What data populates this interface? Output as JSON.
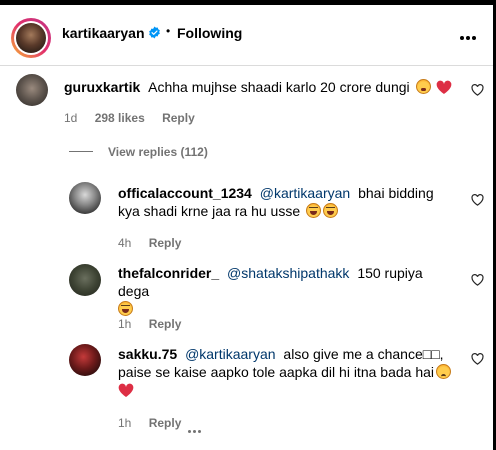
{
  "header": {
    "username": "kartikaaryan",
    "separator": "•",
    "follow_status": "Following"
  },
  "main_comment": {
    "username": "guruxkartik",
    "text": "Achha mujhse shaadi karlo 20 crore dungi",
    "time": "1d",
    "likes": "298 likes",
    "reply_label": "Reply",
    "view_replies": "View replies (112)"
  },
  "replies": [
    {
      "username": "officalaccount_1234",
      "mention": "@kartikaaryan",
      "text": "bhai bidding kya shadi krne jaa ra hu usse",
      "time": "4h",
      "reply_label": "Reply"
    },
    {
      "username": "thefalconrider_",
      "mention": "@shatakshipathakk",
      "text": "150 rupiya dega",
      "time": "1h",
      "reply_label": "Reply"
    },
    {
      "username": "sakku.75",
      "mention": "@kartikaaryan",
      "text": "also give me a chance",
      "text2": "paise se kaise aapko tole aapka dil hi itna bada hai",
      "time": "1h",
      "reply_label": "Reply"
    }
  ],
  "colors": {
    "link": "#00376b",
    "muted": "#737373",
    "verified": "#0095f6",
    "heart": "#e0245e"
  },
  "icons": [
    "verified-badge-icon",
    "more-options-icon",
    "heart-outline-icon",
    "laughing-emoji",
    "blushing-emoji",
    "red-heart-emoji"
  ]
}
